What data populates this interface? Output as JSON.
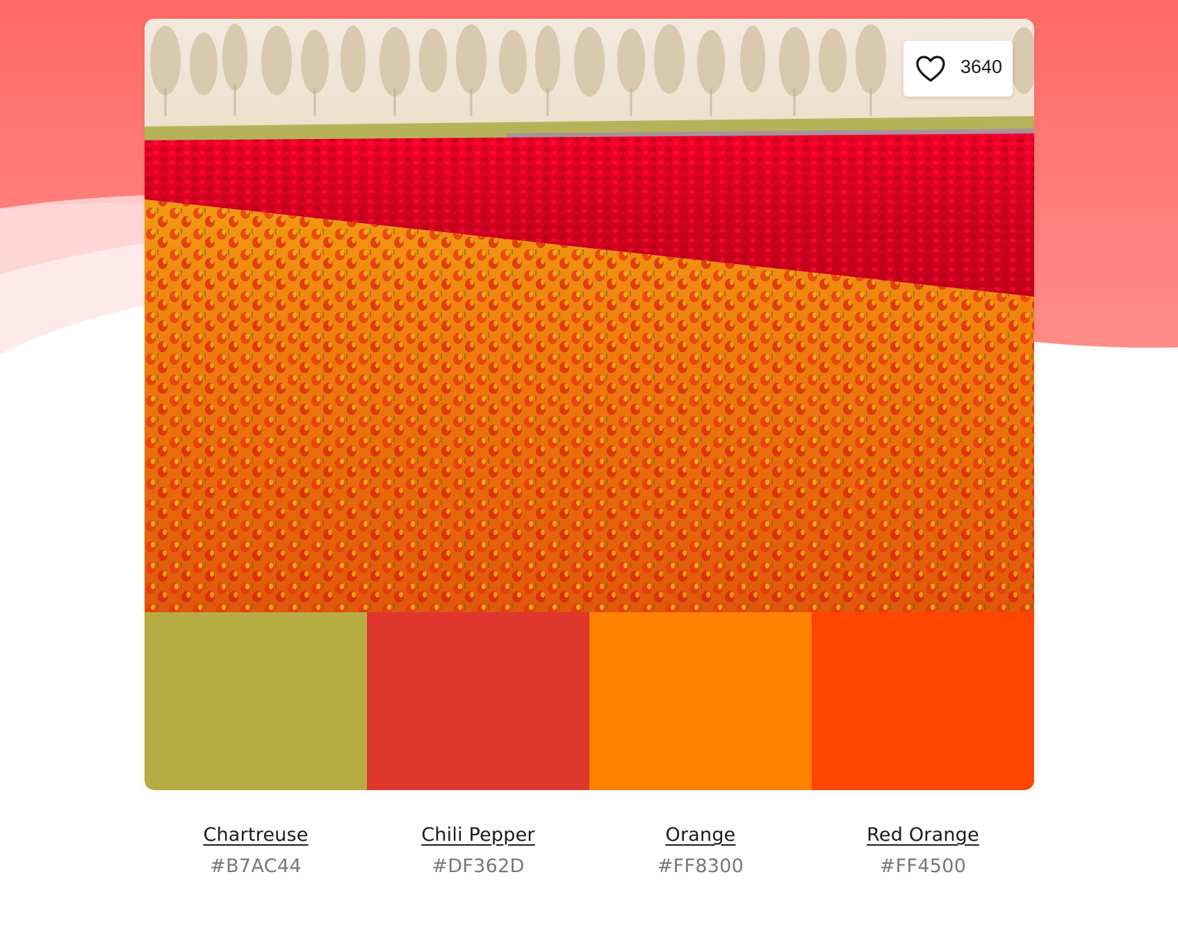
{
  "page": {
    "background_accent": "#FF6B6B"
  },
  "palette_card": {
    "likes": {
      "icon": "heart-icon",
      "count": "3640"
    },
    "photo": {
      "subject": "tulip field"
    },
    "colors": [
      {
        "name": "Chartreuse",
        "hex": "#B7AC44",
        "swatch": "#B7AC44"
      },
      {
        "name": "Chili Pepper",
        "hex": "#DF362D",
        "swatch": "#DF362D"
      },
      {
        "name": "Orange",
        "hex": "#FF8300",
        "swatch": "#FF8300"
      },
      {
        "name": "Red Orange",
        "hex": "#FF4500",
        "swatch": "#FF4500"
      }
    ]
  }
}
